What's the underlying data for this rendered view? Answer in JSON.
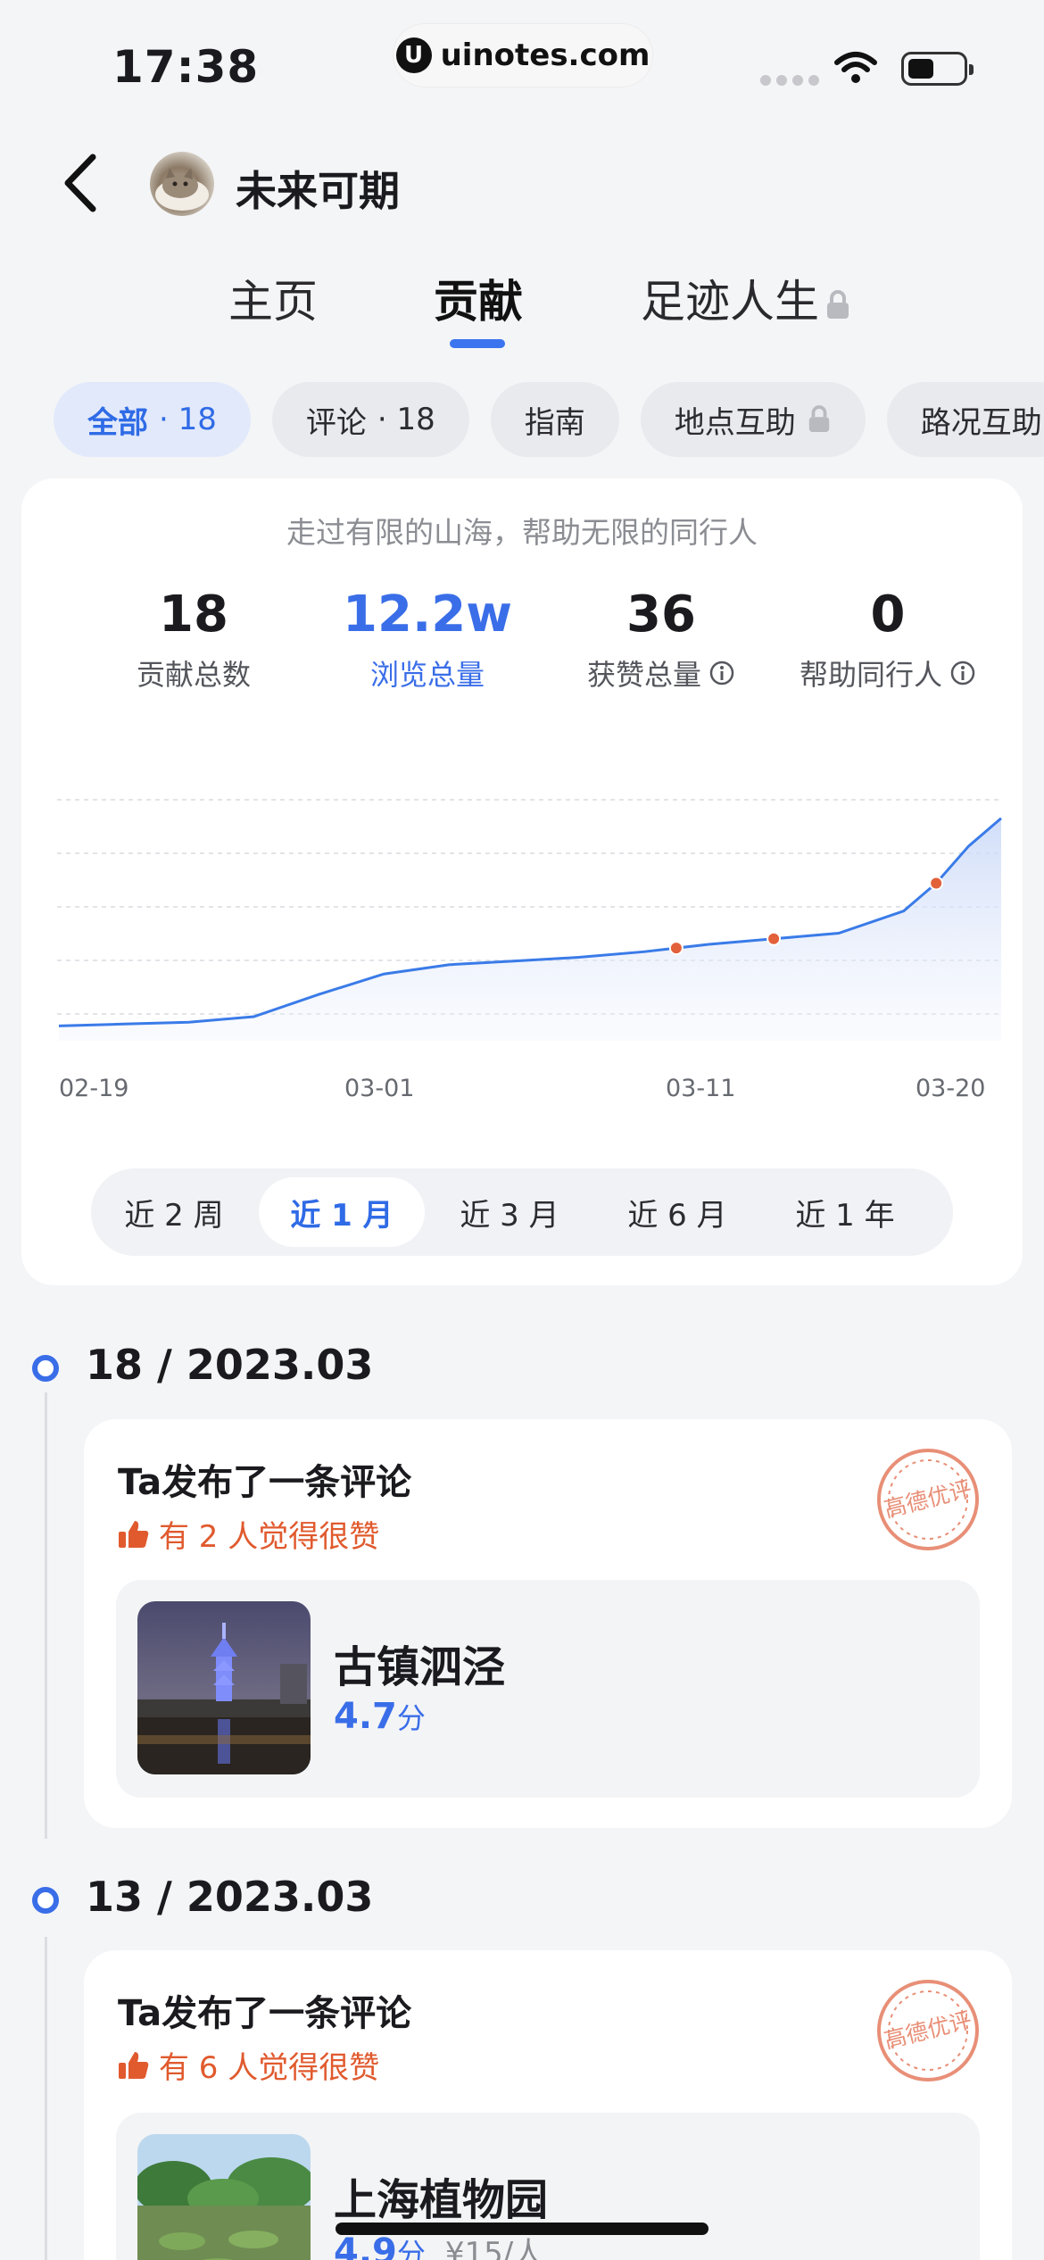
{
  "status_bar": {
    "time": "17:38",
    "site": "uinotes.com",
    "site_logo_char": "U"
  },
  "header": {
    "username": "未来可期",
    "back_icon": "chevron-left-icon",
    "avatar_icon": "cat-avatar"
  },
  "tabs": [
    {
      "label": "主页",
      "active": false
    },
    {
      "label": "贡献",
      "active": true
    },
    {
      "label": "足迹人生",
      "active": false,
      "locked": true
    }
  ],
  "filters": [
    {
      "label": "全部",
      "count": "· 18",
      "active": true
    },
    {
      "label": "评论",
      "count": "· 18",
      "active": false
    },
    {
      "label": "指南",
      "count": "",
      "active": false
    },
    {
      "label": "地点互助",
      "count": "",
      "locked": true,
      "active": false
    },
    {
      "label": "路况互助",
      "count": "",
      "active": false
    }
  ],
  "stats_card": {
    "slogan": "走过有限的山海，帮助无限的同行人",
    "stats": [
      {
        "value": "18",
        "label": "贡献总数"
      },
      {
        "value": "12.2w",
        "label": "浏览总量"
      },
      {
        "value": "36",
        "label": "获赞总量"
      },
      {
        "value": "0",
        "label": "帮助同行人"
      }
    ],
    "ranges": [
      "近 2 周",
      "近 1 月",
      "近 3 月",
      "近 6 月",
      "近 1 年"
    ],
    "selected_range": "近 1 月"
  },
  "chart_data": {
    "type": "area",
    "x_tick_labels": [
      "02-19",
      "03-01",
      "03-11",
      "03-20"
    ],
    "x": [
      "02-19",
      "02-21",
      "02-23",
      "02-25",
      "02-27",
      "03-01",
      "03-03",
      "03-05",
      "03-07",
      "03-09",
      "03-11",
      "03-13",
      "03-15",
      "03-17",
      "03-18",
      "03-19",
      "03-20"
    ],
    "values": [
      8,
      9,
      10,
      13,
      25,
      36,
      41,
      43,
      45,
      48,
      52,
      55,
      58,
      70,
      85,
      105,
      120
    ],
    "markers_at": [
      "03-10",
      "03-13",
      "03-18"
    ],
    "grid": true,
    "accent": "#3a7be8",
    "marker_color": "#e2603a"
  },
  "timeline": [
    {
      "date": "18 / 2023.03",
      "title": "Ta发布了一条评论",
      "likes": "有 2 人觉得很赞",
      "badge": "高德优评",
      "place": {
        "name": "古镇泗泾",
        "score": "4.7",
        "unit": "分",
        "price": ""
      }
    },
    {
      "date": "13 / 2023.03",
      "title": "Ta发布了一条评论",
      "likes": "有 6 人觉得很赞",
      "badge": "高德优评",
      "place": {
        "name": "上海植物园",
        "score": "4.9",
        "unit": "分",
        "price": "¥15/人"
      }
    }
  ],
  "colors": {
    "accent": "#3a6ee8",
    "like": "#e05a2e",
    "stamp": "#e3836a"
  }
}
